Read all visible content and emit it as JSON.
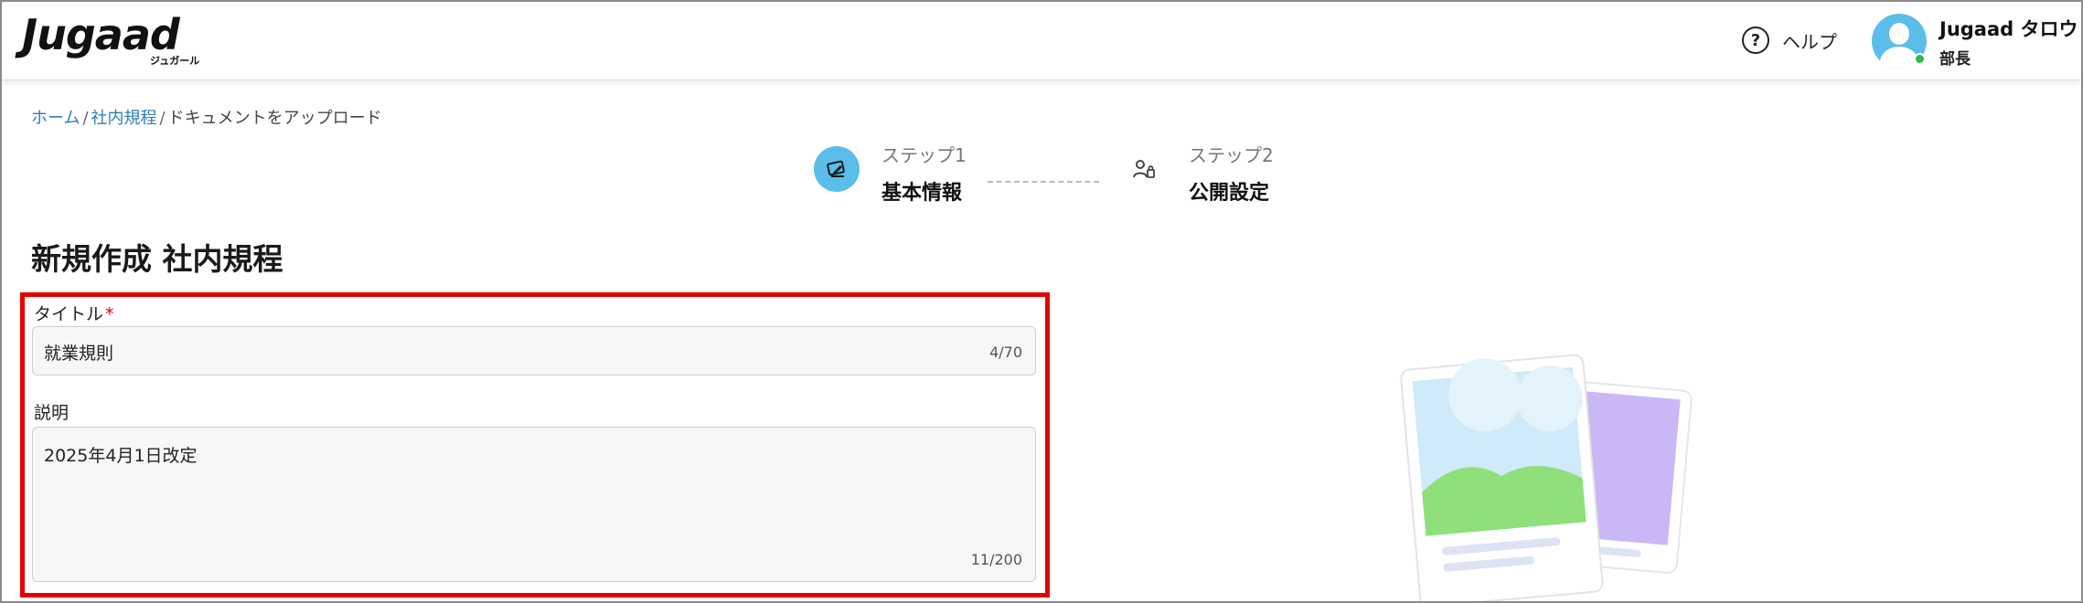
{
  "app": {
    "logo_text": "Jugaad",
    "logo_subtext": "ジュガール"
  },
  "header": {
    "help_label": "ヘルプ",
    "help_icon": "question-circle-icon",
    "user": {
      "name": "Jugaad タロウ",
      "role": "部長",
      "status_color": "#2bbf4a",
      "avatar_color": "#5bbde9"
    }
  },
  "breadcrumb": {
    "items": [
      "ホーム",
      "社内規程",
      "ドキュメントをアップロード"
    ],
    "separator": "/"
  },
  "stepper": {
    "steps": [
      {
        "label": "ステップ1",
        "name": "基本情報",
        "active": true,
        "icon": "edit-document-icon"
      },
      {
        "label": "ステップ2",
        "name": "公開設定",
        "active": false,
        "icon": "user-settings-icon"
      }
    ]
  },
  "page": {
    "title": "新規作成 社内規程"
  },
  "form": {
    "title_field": {
      "label": "タイトル",
      "required_mark": "*",
      "value": "就業規則",
      "counter": "4/70"
    },
    "description_field": {
      "label": "説明",
      "value": "2025年4月1日改定",
      "counter": "11/200"
    }
  },
  "colors": {
    "accent": "#5bbde9",
    "link": "#2f7fb3",
    "highlight_border": "#e60000"
  }
}
